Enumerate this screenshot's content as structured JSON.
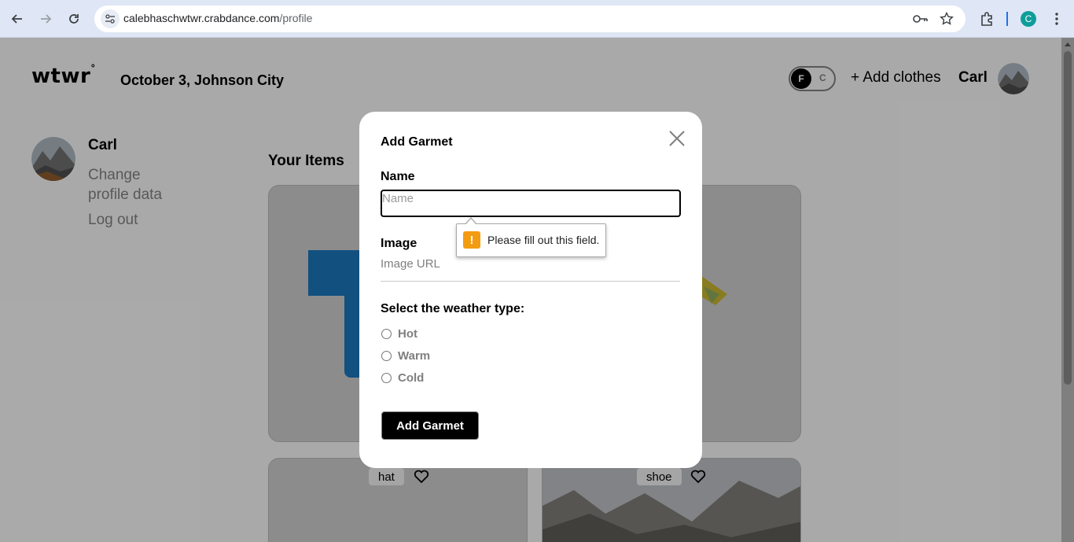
{
  "browser": {
    "url_host": "calebhaschwtwr.crabdance.com",
    "url_path": "/profile",
    "profile_initial": "C"
  },
  "header": {
    "logo": "wtwr",
    "logo_mark": "°",
    "date_location": "October 3, Johnson City",
    "toggle_on": "F",
    "toggle_off": "C",
    "add_clothes": "+ Add clothes",
    "user_name": "Carl"
  },
  "sidebar": {
    "name": "Carl",
    "change_profile_line1": "Change",
    "change_profile_line2": "profile data",
    "logout": "Log out"
  },
  "main": {
    "section_title": "Your Items",
    "cards": [
      {
        "tag": ""
      },
      {
        "tag": ""
      },
      {
        "tag": "hat"
      },
      {
        "tag": "shoe"
      }
    ]
  },
  "modal": {
    "title": "Add Garmet",
    "name_label": "Name",
    "name_placeholder": "Name",
    "image_label": "Image",
    "image_placeholder": "Image URL",
    "weather_title": "Select the weather type:",
    "options": [
      "Hot",
      "Warm",
      "Cold"
    ],
    "submit": "Add Garmet"
  },
  "validation": {
    "message": "Please fill out this field.",
    "icon": "!"
  },
  "colors": {
    "chrome": "#dfe6f5",
    "page_bg": "#f3f3f3",
    "warning": "#f39c12",
    "profile": "#0f9d9a"
  }
}
